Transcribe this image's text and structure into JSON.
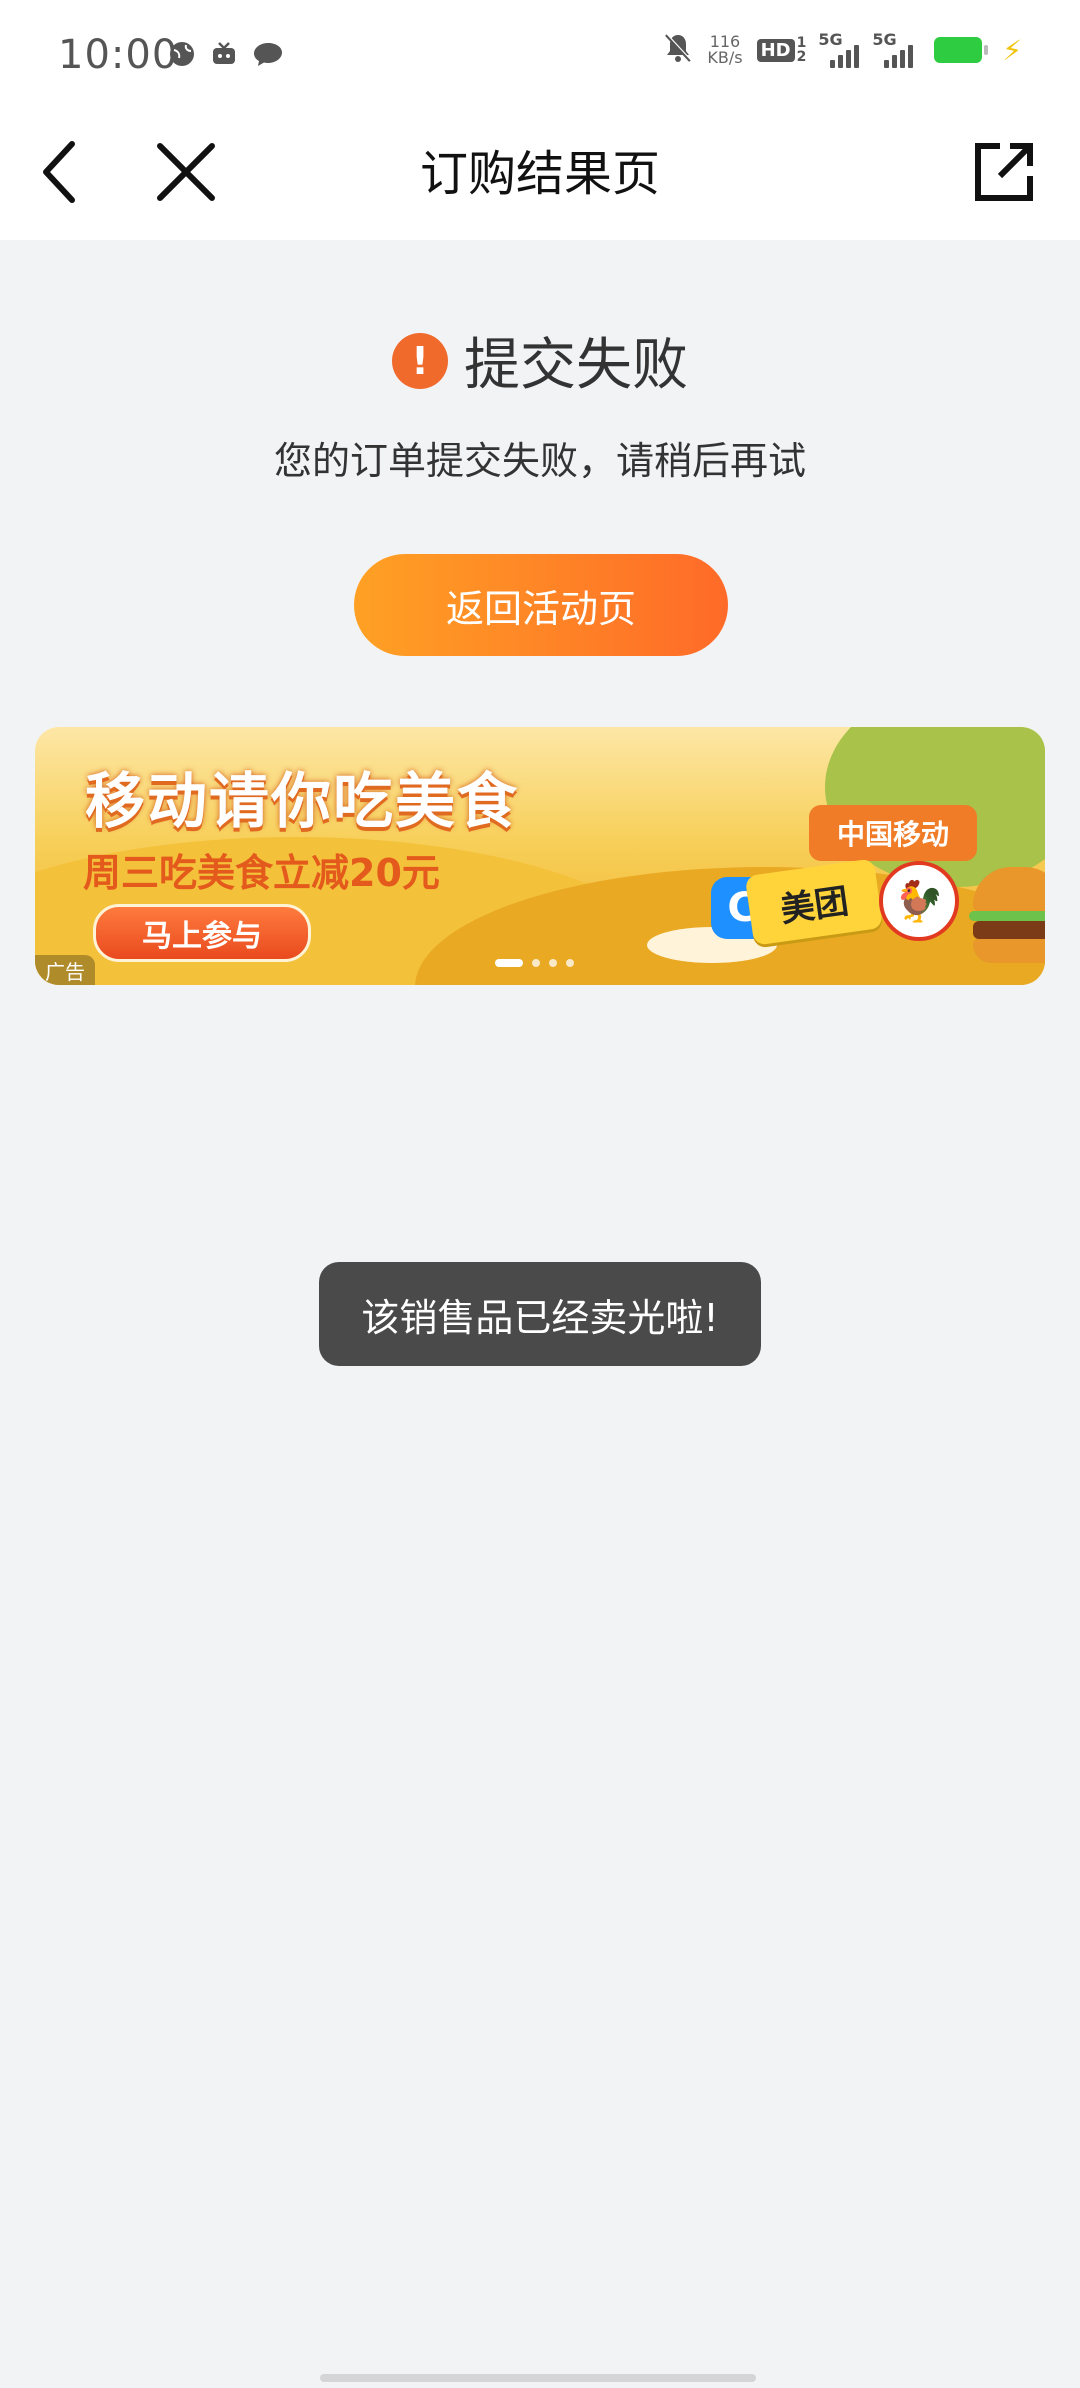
{
  "status_bar": {
    "time": "10:00",
    "left_icons": [
      "globe-icon",
      "tv-icon",
      "chat-bubble-icon"
    ],
    "net_speed_value": "116",
    "net_speed_unit": "KB/s",
    "hd_label": "HD",
    "sim1_label": "1",
    "sim2_label": "2",
    "signal1_label": "5G",
    "signal2_label": "5G",
    "battery_color": "#2ecc40"
  },
  "nav": {
    "title": "订购结果页",
    "back_icon": "chevron-left-icon",
    "close_icon": "close-icon",
    "share_icon": "share-external-icon"
  },
  "result": {
    "icon_glyph": "!",
    "title": "提交失败",
    "description": "您的订单提交失败，请稍后再试",
    "return_button_label": "返回活动页",
    "accent_color": "#ff7a26"
  },
  "banner": {
    "title": "移动请你吃美食",
    "subtitle": "周三吃美食立减20元",
    "cta_label": "马上参与",
    "brand_tag": "中国移动",
    "partner_badge": "美团",
    "partner_logo_glyph": "C",
    "ad_label": "广告",
    "slide_count": 4,
    "active_slide": 1
  },
  "toast": {
    "message": "该销售品已经卖光啦!"
  }
}
